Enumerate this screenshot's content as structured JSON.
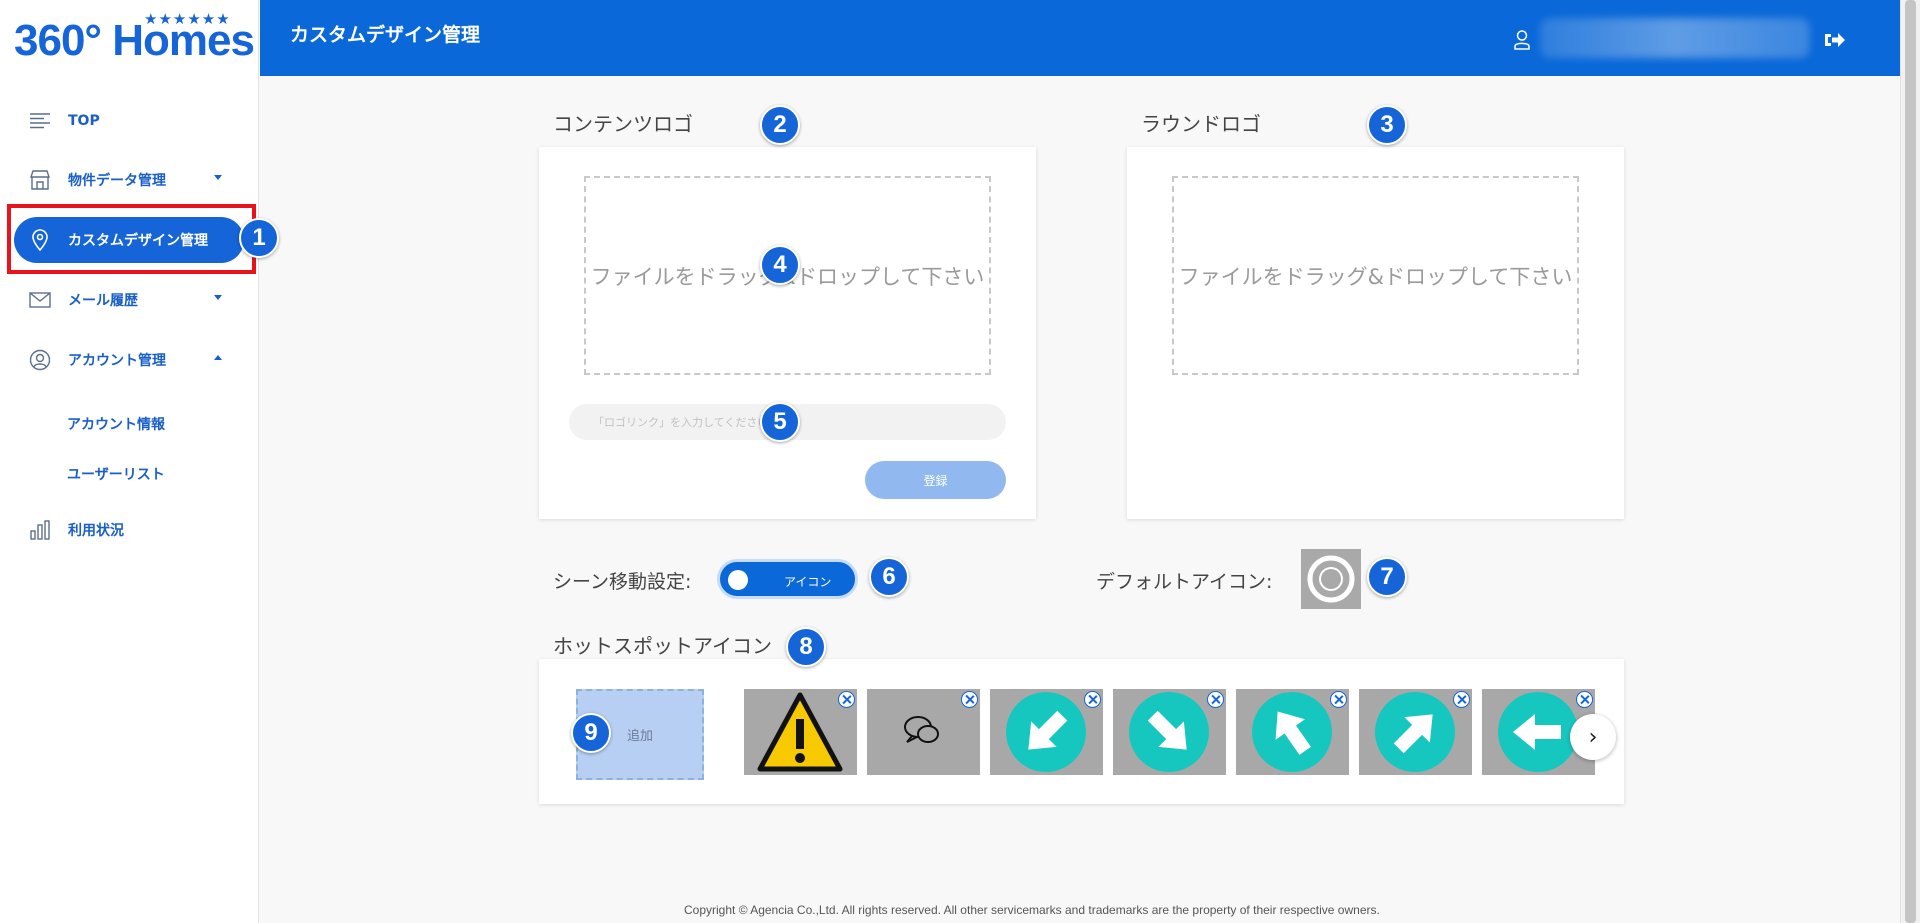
{
  "logo": {
    "text": "360° Homes",
    "stars": "★★★★★★"
  },
  "header": {
    "title": "カスタムデザイン管理"
  },
  "sidebar": {
    "items": [
      {
        "label": "TOP"
      },
      {
        "label": "物件データ管理"
      },
      {
        "label": "カスタムデザイン管理"
      },
      {
        "label": "メール履歴"
      },
      {
        "label": "アカウント管理"
      }
    ],
    "sub_items": [
      {
        "label": "アカウント情報"
      },
      {
        "label": "ユーザーリスト"
      }
    ],
    "usage_label": "利用状況"
  },
  "content_logo": {
    "title": "コンテンツロゴ",
    "dropzone_text": "ファイルをドラッグ&ドロップして下さい",
    "link_placeholder": "「ロゴリンク」を入力してください",
    "register_label": "登録"
  },
  "round_logo": {
    "title": "ラウンドロゴ",
    "dropzone_text": "ファイルをドラッグ&ドロップして下さい"
  },
  "scene_setting": {
    "label": "シーン移動設定:",
    "toggle_label": "アイコン"
  },
  "default_icon": {
    "label": "デフォルトアイコン:"
  },
  "hotspot": {
    "title": "ホットスポットアイコン",
    "add_label": "追加",
    "icons": [
      "warning-icon",
      "speech-bubble-icon",
      "arrow-down-left-icon",
      "arrow-down-right-icon",
      "arrow-up-left-icon",
      "arrow-up-right-icon",
      "arrow-left-icon"
    ]
  },
  "badges": [
    "1",
    "2",
    "3",
    "4",
    "5",
    "6",
    "7",
    "8",
    "9"
  ],
  "footer": {
    "text": "Copyright © Agencia Co.,Ltd. All rights reserved. All other servicemarks and trademarks are the property of their respective owners."
  },
  "colors": {
    "primary": "#0a68d8",
    "accent_light": "#91b9ef",
    "highlight": "#e8141b",
    "teal": "#16c7c0"
  }
}
